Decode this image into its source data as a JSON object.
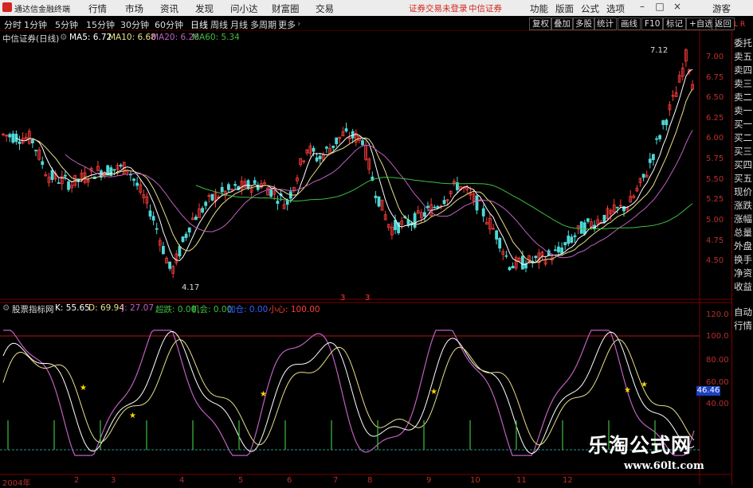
{
  "menubar": {
    "app_title": "通达信金融终端",
    "items": [
      "行情",
      "市场",
      "资讯",
      "发现",
      "问小达",
      "财富圈",
      "交易"
    ],
    "login_status": "证券交易未登录",
    "broker": "中信证券",
    "right_items": [
      "功能",
      "版面",
      "公式",
      "选项"
    ],
    "guest": "游客"
  },
  "periods": [
    "分时",
    "1分钟",
    "5分钟",
    "15分钟",
    "30分钟",
    "60分钟",
    "日线",
    "周线",
    "月线",
    "多周期",
    "更多"
  ],
  "active_period": "日线",
  "right_tools": [
    "复权",
    "叠加",
    "多股",
    "统计",
    "画线",
    "F10",
    "标记",
    "+自选",
    "返回"
  ],
  "kline": {
    "title": "中信证券(日线)",
    "ma5": "MA5: 6.72",
    "ma10": "MA10: 6.68",
    "ma20": "MA20: 6.26",
    "ma60": "MA60: 5.34",
    "colors": {
      "up": "#ff3b3b",
      "down": "#4fd8d8",
      "ma5": "#ffffff",
      "ma10": "#e8e08a",
      "ma20": "#c060c0",
      "ma60": "#3fbf3f"
    },
    "high_label": "7.12",
    "low_label": "4.17",
    "y_ticks": [
      "7.00",
      "6.75",
      "6.50",
      "6.25",
      "6.00",
      "5.75",
      "5.50",
      "5.25",
      "5.00",
      "4.75",
      "4.50"
    ],
    "markers": [
      "3",
      "3"
    ]
  },
  "indicator": {
    "title": "股票指标网",
    "k": "K: 55.65",
    "d": "D: 69.94",
    "j": "J: 27.07",
    "chaodie": "超跌: 0.00",
    "jihui": "机会: 0.00",
    "jiabing": "加仓: 0.00",
    "xiaoxin": "小心: 100.00",
    "y_ticks": [
      "120.0",
      "100.0",
      "80.00",
      "60.00",
      "40.00"
    ],
    "current": "46.46"
  },
  "x_ticks": [
    "2004年",
    "2",
    "3",
    "4",
    "5",
    "6",
    "7",
    "8",
    "9",
    "10",
    "11",
    "12"
  ],
  "right_panel": [
    "委托",
    "卖五",
    "卖四",
    "卖三",
    "卖二",
    "卖一",
    "买一",
    "买二",
    "买三",
    "买四",
    "买五",
    "现价",
    "涨跌",
    "涨幅",
    "总量",
    "外盘",
    "换手",
    "净资",
    "收益",
    "自动",
    "行情"
  ],
  "watermark": {
    "text": "乐淘公式网",
    "url": "www.60lt.com"
  }
}
